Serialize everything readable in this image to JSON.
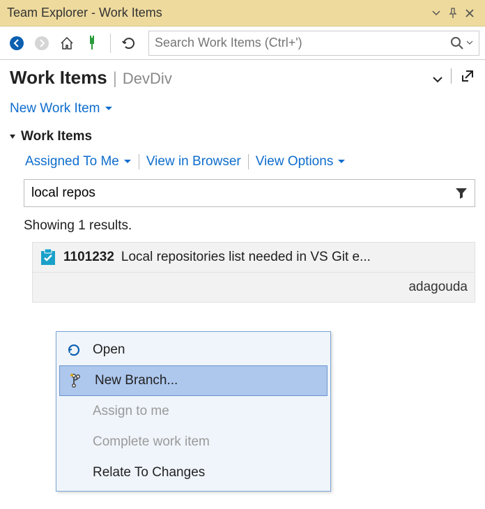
{
  "window": {
    "title": "Team Explorer - Work Items"
  },
  "toolbar": {
    "search_placeholder": "Search Work Items (Ctrl+')"
  },
  "header": {
    "title": "Work Items",
    "project": "DevDiv"
  },
  "actions": {
    "new_work_item": "New Work Item"
  },
  "subhead": {
    "label": "Work Items"
  },
  "filters": {
    "assigned": "Assigned To Me",
    "view_browser": "View in Browser",
    "view_options": "View Options"
  },
  "filterbox": {
    "value": "local repos"
  },
  "results": {
    "label": "Showing 1 results."
  },
  "work_item": {
    "id": "1101232",
    "title": "Local repositories list needed in VS Git e...",
    "assignee_suffix": "adagouda"
  },
  "context_menu": {
    "open": "Open",
    "new_branch": "New Branch...",
    "assign_to_me": "Assign to me",
    "complete": "Complete work item",
    "relate": "Relate To Changes"
  }
}
